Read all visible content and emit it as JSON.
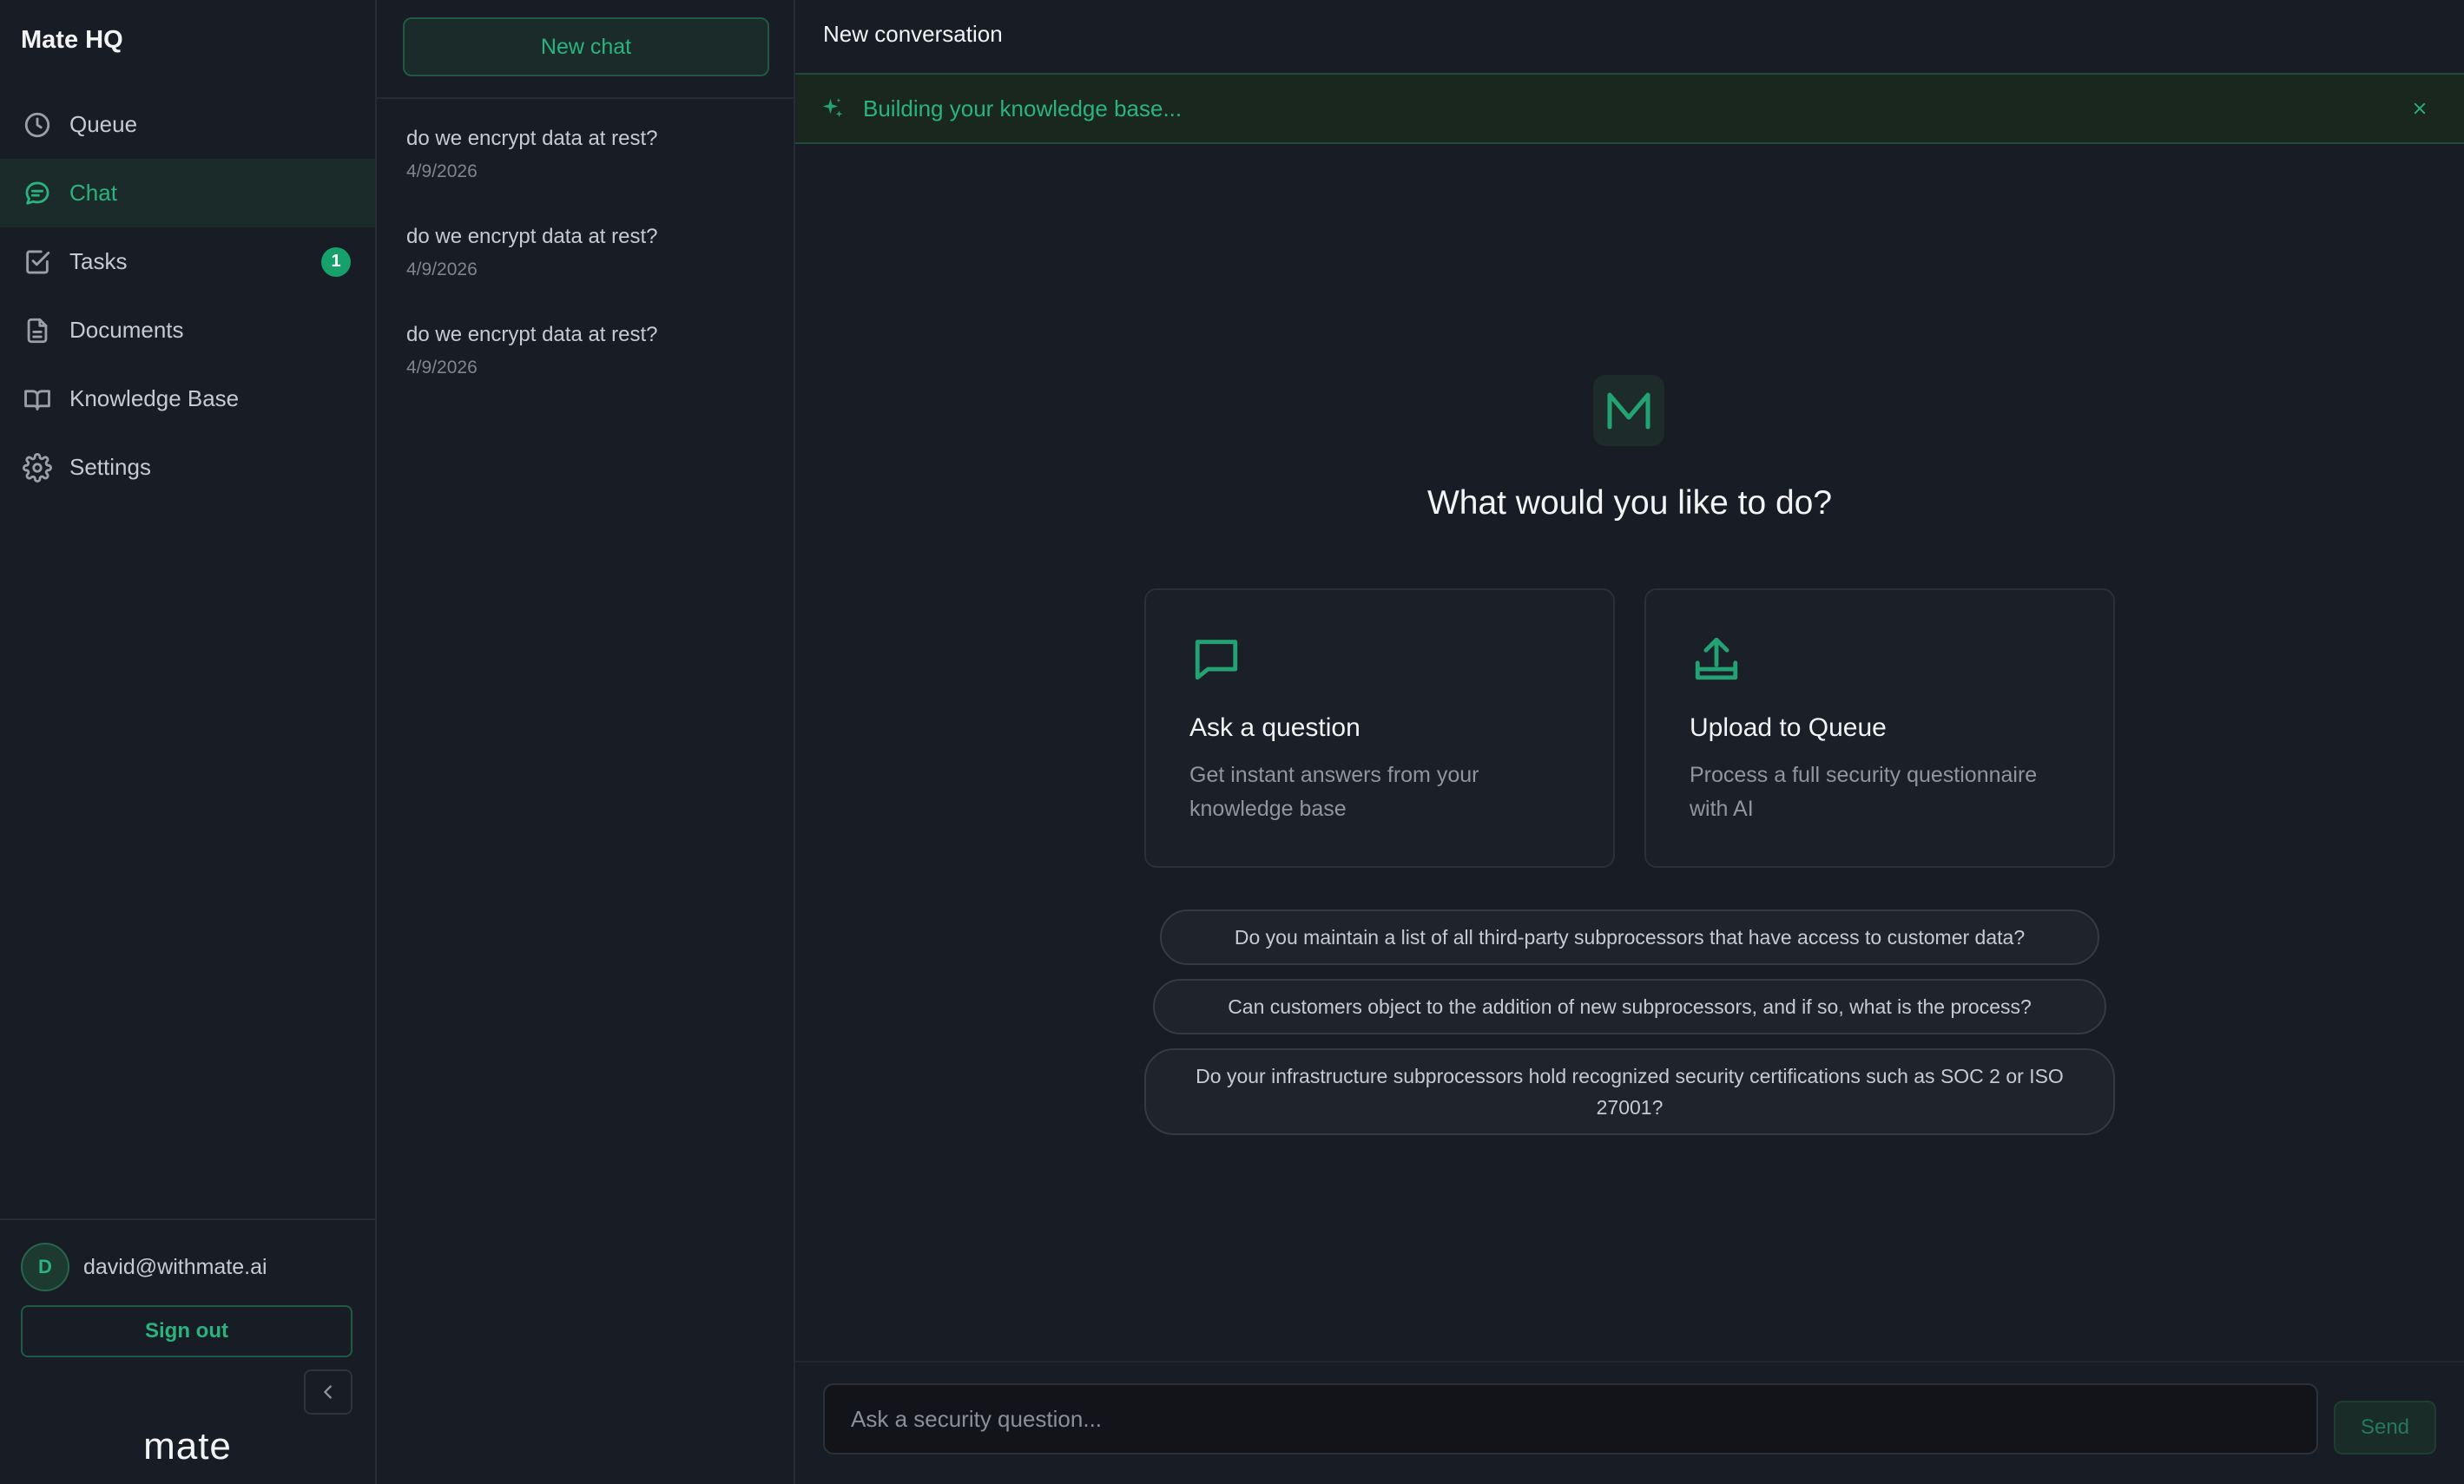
{
  "app": {
    "name": "Mate HQ",
    "footer_logo": "mate"
  },
  "colors": {
    "accent": "#2bb37f",
    "background": "#181c24",
    "badge": "#16a06b"
  },
  "sidebar": {
    "items": [
      {
        "label": "Queue",
        "icon": "clock-icon",
        "active": false
      },
      {
        "label": "Chat",
        "icon": "chat-bubble-icon",
        "active": true
      },
      {
        "label": "Tasks",
        "icon": "checkbox-icon",
        "active": false,
        "badge": "1"
      },
      {
        "label": "Documents",
        "icon": "document-icon",
        "active": false
      },
      {
        "label": "Knowledge Base",
        "icon": "book-icon",
        "active": false
      },
      {
        "label": "Settings",
        "icon": "gear-icon",
        "active": false
      }
    ],
    "user": {
      "initial": "D",
      "email": "david@withmate.ai"
    },
    "sign_out_label": "Sign out"
  },
  "conversations": {
    "new_chat_label": "New chat",
    "items": [
      {
        "title": "do we encrypt data at rest?",
        "date": "4/9/2026"
      },
      {
        "title": "do we encrypt data at rest?",
        "date": "4/9/2026"
      },
      {
        "title": "do we encrypt data at rest?",
        "date": "4/9/2026"
      }
    ]
  },
  "main": {
    "title": "New conversation",
    "banner": {
      "text": "Building your knowledge base..."
    },
    "logo_letter": "M",
    "headline": "What would you like to do?",
    "cards": [
      {
        "icon": "chat-bubble-icon",
        "title": "Ask a question",
        "description": "Get instant answers from your knowledge base"
      },
      {
        "icon": "upload-icon",
        "title": "Upload to Queue",
        "description": "Process a full security questionnaire with AI"
      }
    ],
    "suggestions": [
      "Do you maintain a list of all third-party subprocessors that have access to customer data?",
      "Can customers object to the addition of new subprocessors, and if so, what is the process?",
      "Do your infrastructure subprocessors hold recognized security certifications such as SOC 2 or ISO 27001?"
    ],
    "composer": {
      "placeholder": "Ask a security question...",
      "value": ""
    },
    "send_label": "Send"
  }
}
